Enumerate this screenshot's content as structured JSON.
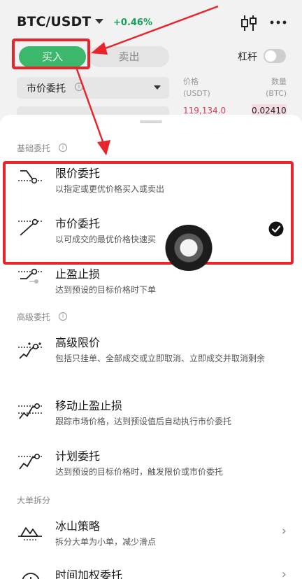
{
  "header": {
    "pair": "BTC/USDT",
    "change": "+0.46%",
    "kline_icon": "candlestick-icon",
    "more_icon": "more-icon"
  },
  "trade": {
    "buy_label": "买入",
    "sell_label": "卖出",
    "leverage_label": "杠杆",
    "leverage_on": false,
    "order_type": "市价委托",
    "price_header": [
      "价格",
      "(USDT)"
    ],
    "qty_header": [
      "数量",
      "(BTC)"
    ],
    "ask_price": "119,134.0",
    "ask_qty": "0.02410"
  },
  "sheet": {
    "sections": [
      {
        "title": "基础委托",
        "options": [
          {
            "title": "限价委托",
            "desc": "以指定或更优价格买入或卖出",
            "icon": "limit-order-icon",
            "selected": false
          },
          {
            "title": "市价委托",
            "desc": "以可成交的最优价格快速买",
            "icon": "market-order-icon",
            "selected": true
          },
          {
            "title": "止盈止损",
            "desc": "达到预设的目标价格时下单",
            "icon": "tp-sl-icon",
            "selected": false
          }
        ]
      },
      {
        "title": "高级委托",
        "options": [
          {
            "title": "高级限价",
            "desc": "包括只挂单、全部成交或立即取消、立即成交并取消剩余",
            "icon": "advanced-limit-icon"
          },
          {
            "title": "移动止盈止损",
            "desc": "跟踪市场价格，达到预设值后自动执行市价委托",
            "icon": "trailing-stop-icon"
          },
          {
            "title": "计划委托",
            "desc": "达到预设的目标价格时，触发限价或市价委托",
            "icon": "trigger-order-icon"
          }
        ]
      },
      {
        "title": "大单拆分",
        "options": [
          {
            "title": "冰山策略",
            "desc": "拆分大单为小单，减少滑点",
            "icon": "iceberg-icon"
          },
          {
            "title": "时间加权委托",
            "icon": "twap-icon"
          }
        ]
      }
    ]
  },
  "colors": {
    "buy_green": "#3cb86d",
    "change_green": "#18a05c",
    "ask_red": "#d3405c",
    "annotation_red": "#e8252a"
  }
}
